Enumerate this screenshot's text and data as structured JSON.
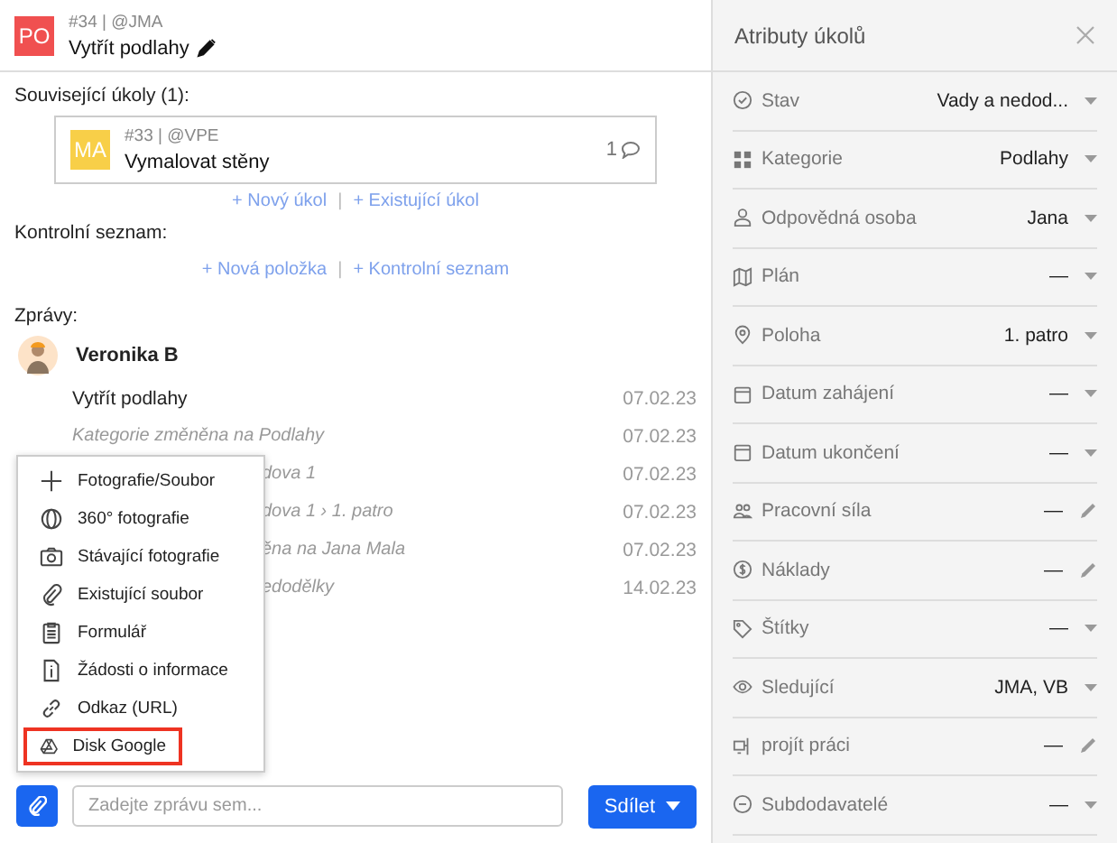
{
  "task": {
    "avatar": "PO",
    "meta": "#34 | @JMA",
    "title": "Vytřít podlahy"
  },
  "related": {
    "heading": "Související úkoly (1):",
    "items": [
      {
        "avatar": "MA",
        "meta": "#33 | @VPE",
        "title": "Vymalovat stěny",
        "comments": "1"
      }
    ],
    "links": [
      "+ Nový úkol",
      "|",
      "+ Existující úkol"
    ]
  },
  "checklist": {
    "heading": "Kontrolní seznam:",
    "links": [
      "+ Nová položka",
      "|",
      "+ Kontrolní seznam"
    ]
  },
  "messages": {
    "heading": "Zprávy:",
    "author": "Veronika B",
    "items": [
      {
        "kind": "title",
        "text": "Vytřít podlahy",
        "date": "07.02.23"
      },
      {
        "kind": "event",
        "text": "Kategorie změněna na Podlahy",
        "date": "07.02.23"
      },
      {
        "kind": "covered",
        "text": "dova 1",
        "date": "07.02.23"
      },
      {
        "kind": "covered",
        "text": "dova 1 › 1. patro",
        "date": "07.02.23"
      },
      {
        "kind": "covered",
        "text": "ěna na Jana Mala",
        "date": "07.02.23"
      },
      {
        "kind": "covered",
        "text": "edodělky",
        "date": "14.02.23"
      }
    ]
  },
  "attach_menu": [
    {
      "label": "Fotografie/Soubor",
      "highlighted": false
    },
    {
      "label": "360° fotografie",
      "highlighted": false
    },
    {
      "label": "Stávající fotografie",
      "highlighted": false
    },
    {
      "label": "Existující soubor",
      "highlighted": false
    },
    {
      "label": "Formulář",
      "highlighted": false
    },
    {
      "label": "Žádosti o informace",
      "highlighted": false
    },
    {
      "label": "Odkaz (URL)",
      "highlighted": false
    },
    {
      "label": "Disk Google",
      "highlighted": true
    }
  ],
  "composer": {
    "placeholder": "Zadejte zprávu sem...",
    "send": "Sdílet"
  },
  "attributes": {
    "title": "Atributy úkolů",
    "rows": [
      {
        "label": "Stav",
        "value": "Vady a nedod...",
        "kind": "select"
      },
      {
        "label": "Kategorie",
        "value": "Podlahy",
        "kind": "select"
      },
      {
        "label": "Odpovědná osoba",
        "value": "Jana",
        "kind": "select"
      },
      {
        "label": "Plán",
        "value": "—",
        "kind": "select"
      },
      {
        "label": "Poloha",
        "value": "1. patro",
        "kind": "select"
      },
      {
        "label": "Datum zahájení",
        "value": "—",
        "kind": "select"
      },
      {
        "label": "Datum ukončení",
        "value": "—",
        "kind": "select"
      },
      {
        "label": "Pracovní síla",
        "value": "—",
        "kind": "editable"
      },
      {
        "label": "Náklady",
        "value": "—",
        "kind": "editable"
      },
      {
        "label": "Štítky",
        "value": "—",
        "kind": "select"
      },
      {
        "label": "Sledující",
        "value": "JMA, VB",
        "kind": "select"
      },
      {
        "label": "projít práci",
        "value": "—",
        "kind": "editable"
      },
      {
        "label": "Subdodavatelé",
        "value": "—",
        "kind": "select"
      }
    ]
  }
}
